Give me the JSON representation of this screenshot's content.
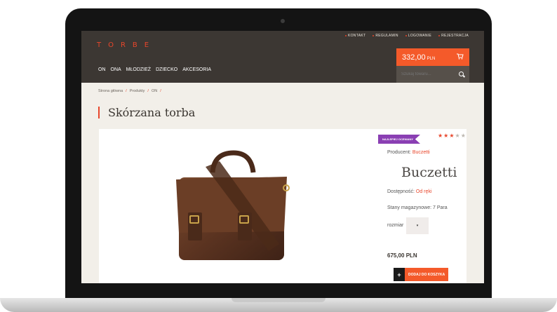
{
  "header": {
    "logo": "TORBE",
    "top_links": [
      "KONTAKT",
      "REGULAMIN",
      "LOGOWANIE",
      "REJESTRACJA"
    ],
    "nav": [
      "ON",
      "ONA",
      "MŁODZIEŻ",
      "DZIECKO",
      "AKCESORIA"
    ],
    "cart": {
      "amount": "332,00",
      "currency": "PLN"
    },
    "search": {
      "placeholder": "Szukaj towaru..."
    }
  },
  "breadcrumb": [
    "Strona główna",
    "Produkty",
    "ON"
  ],
  "product": {
    "title": "Skórzana torba",
    "badge": "NAJLEPIEJ OCENIANY",
    "rating": 3,
    "rating_max": 5,
    "producer_label": "Producent:",
    "producer": "Buczetti",
    "brand_logo": "Buczetti",
    "availability_label": "Dostępność:",
    "availability": "Od ręki",
    "stock": "Stany magazynowe: 7 Para",
    "size_label": "rozmiar",
    "size_value": "▾",
    "price": "675,00 PLN",
    "add_plus": "+",
    "add_label": "DODAJ DO KOSZYKA"
  },
  "colors": {
    "accent": "#f45a2a",
    "header_bg": "#3c3733",
    "badge": "#8a3fb3"
  }
}
